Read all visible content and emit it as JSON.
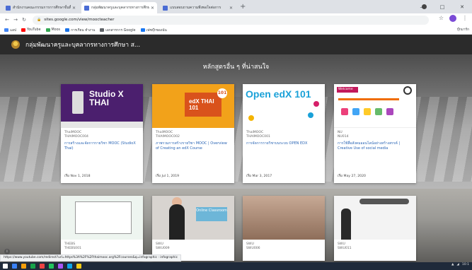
{
  "browser": {
    "tabs": [
      {
        "title": "สำนักงานคณะกรรมการการศึกษาขั้นพื้นฐาน",
        "active": false
      },
      {
        "title": "กลุ่มพัฒนาครูและบุคลากรทางการศึกษา",
        "active": true
      },
      {
        "title": "แบบสอบถามความพึงพอใจต่อการ",
        "active": false
      }
    ],
    "new_tab": "+",
    "url": "sites.google.com/view/moocteacher",
    "window_controls": [
      "—",
      "□",
      "✕"
    ],
    "bookmarks": [
      {
        "label": "แอป",
        "color": "#4285f4"
      },
      {
        "label": "YouTube",
        "color": "#ff0000"
      },
      {
        "label": "Moos",
        "color": "#34a853"
      },
      {
        "label": "การเรียน ทำงาน",
        "color": "#1a73e8"
      },
      {
        "label": "เอกสารการ Google",
        "color": "#5f6368"
      },
      {
        "label": "เฟซบุ๊กของฉัน",
        "color": "#1877f2"
      }
    ],
    "bookmarks_right": "บุ๊กมาร์ก"
  },
  "site": {
    "title": "กลุ่มพัฒนาครูและบุคลากรทางการศึกษา ส...",
    "section_title": "หลักสูตรอื่น ๆ ที่น่าสนใจ"
  },
  "courses": [
    {
      "org": "ThaiMOOC",
      "code": "THAIMOOC004",
      "title": "การสร้างและจัดการรายวิชา MOOC (StudioX Thai)",
      "date": "เริ่ม Nov 1, 2018",
      "thumb_text": "Studio X THAI"
    },
    {
      "org": "ThaiMOOC",
      "code": "THAIMOOC002",
      "title": "ภาพรวมการสร้างรายวิชา MOOC | Overview of Creating an edX Course",
      "date": "เริ่ม Jul 1, 2019",
      "thumb_text": "edX THAI 101"
    },
    {
      "org": "ThaiMOOC",
      "code": "THAIMOOC001",
      "title": "การจัดการรายวิชาบนระบบ OPEN EDX",
      "date": "เริ่ม Mar 3, 2017",
      "thumb_text": "Open edX 101"
    },
    {
      "org": "NU",
      "code": "NU014",
      "title": "การใช้สื่อสังคมออนไลน์อย่างสร้างสรรค์ | Creative Use of social media",
      "date": "เริ่ม May 27, 2020",
      "thumb_text": "Welcome"
    }
  ],
  "courses_row2": [
    {
      "org": "THEBS",
      "code": "THEBS001"
    },
    {
      "org": "SWU",
      "code": "SWU009",
      "thumb_text": "Online Classroom"
    },
    {
      "org": "SWU",
      "code": "SWU006"
    },
    {
      "org": "SWU",
      "code": "SWU011"
    }
  ],
  "status_url": "https://www.youtube.com/redirect?url=https%3A%2F%2Fthaimooc.org%2Fcourses&q=infographic : infographic",
  "taskbar": {
    "clock": "10:1",
    "colors": [
      "#ffffff",
      "#3b82f6",
      "#f59e0b",
      "#16a34a",
      "#ef4444",
      "#22c55e",
      "#a855f7",
      "#0ea5e9",
      "#facc15"
    ]
  }
}
